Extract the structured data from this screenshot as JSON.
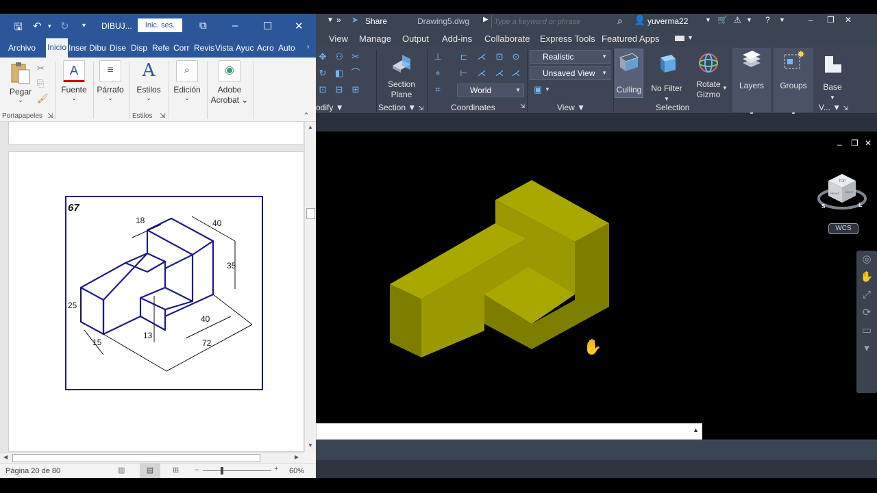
{
  "word": {
    "doc_name": "DIBUJ...",
    "signin": "Inic. ses.",
    "tabs": [
      "Archivo",
      "Inicio",
      "Inser",
      "Dibu",
      "Dise",
      "Disp",
      "Refe",
      "Corr",
      "Revis",
      "Vista",
      "Ayuc",
      "Acro",
      "Auto"
    ],
    "ribbon": {
      "paste": "Pegar",
      "font": "Fuente",
      "paragraph": "Párrafo",
      "styles": "Estilos",
      "editing": "Edición",
      "adobe": "Adobe",
      "acrobat": "Acrobat",
      "group_clipboard": "Portapapeles",
      "group_styles": "Estilos"
    },
    "drawing": {
      "number": "67",
      "dims": [
        "18",
        "40",
        "35",
        "25",
        "15",
        "13",
        "40",
        "72"
      ]
    },
    "status": {
      "page": "Página 20 de 80",
      "zoom": "60%"
    }
  },
  "autocad": {
    "share": "Share",
    "file": "Drawing5.dwg",
    "search_placeholder": "Type a keyword or phrase",
    "user": "yuverma22",
    "tabs": [
      "View",
      "Manage",
      "Output",
      "Add-ins",
      "Collaborate",
      "Express Tools",
      "Featured Apps"
    ],
    "ribbon": {
      "section_plane_1": "Section",
      "section_plane_2": "Plane",
      "group_modify": "odify",
      "group_section": "Section",
      "group_coordinates": "Coordinates",
      "group_view": "View",
      "group_selection": "Selection",
      "visual_style": "Realistic",
      "saved_view": "Unsaved View",
      "ucs": "World",
      "culling": "Culling",
      "no_filter": "No Filter",
      "rotate_gizmo_1": "Rotate",
      "rotate_gizmo_2": "Gizmo",
      "layers": "Layers",
      "groups": "Groups",
      "base": "Base",
      "group_v": "V..."
    },
    "viewcube": {
      "wcs": "WCS",
      "top": "TOP",
      "front": "FRONT",
      "right": "RIGHT",
      "s": "S",
      "e": "E"
    },
    "colors": {
      "model_top": "#a8a800",
      "model_front": "#9a9a00",
      "model_side": "#7d7d00"
    }
  }
}
